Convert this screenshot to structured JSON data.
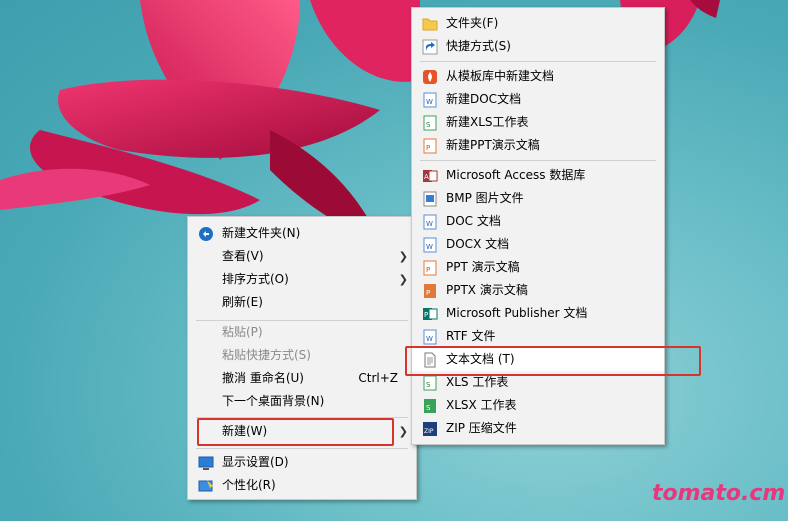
{
  "context_menu": {
    "items": [
      {
        "label": "新建文件夹(N)",
        "icon": "new-folder-icon"
      },
      {
        "label": "查看(V)",
        "submenu": true
      },
      {
        "label": "排序方式(O)",
        "submenu": true
      },
      {
        "label": "刷新(E)"
      },
      {
        "label": "粘贴(P)",
        "disabled": true
      },
      {
        "label": "粘贴快捷方式(S)",
        "disabled": true
      },
      {
        "label": "撤消 重命名(U)",
        "shortcut": "Ctrl+Z"
      },
      {
        "label": "下一个桌面背景(N)"
      },
      {
        "label": "新建(W)",
        "submenu": true,
        "highlighted": true
      },
      {
        "label": "显示设置(D)",
        "icon": "display-settings-icon"
      },
      {
        "label": "个性化(R)",
        "icon": "personalize-icon"
      }
    ]
  },
  "new_submenu": {
    "items": [
      {
        "label": "文件夹(F)",
        "icon": "folder-icon"
      },
      {
        "label": "快捷方式(S)",
        "icon": "shortcut-icon"
      },
      {
        "label": "从模板库中新建文档",
        "icon": "template-icon"
      },
      {
        "label": "新建DOC文档",
        "icon": "doc-icon"
      },
      {
        "label": "新建XLS工作表",
        "icon": "xls-icon"
      },
      {
        "label": "新建PPT演示文稿",
        "icon": "ppt-icon"
      },
      {
        "label": "Microsoft Access 数据库",
        "icon": "access-icon"
      },
      {
        "label": "BMP 图片文件",
        "icon": "bmp-icon"
      },
      {
        "label": "DOC 文档",
        "icon": "doc-icon"
      },
      {
        "label": "DOCX 文档",
        "icon": "docx-icon"
      },
      {
        "label": "PPT 演示文稿",
        "icon": "ppt-icon"
      },
      {
        "label": "PPTX 演示文稿",
        "icon": "pptx-icon"
      },
      {
        "label": "Microsoft Publisher 文档",
        "icon": "publisher-icon"
      },
      {
        "label": "RTF 文件",
        "icon": "rtf-icon"
      },
      {
        "label": "文本文档 (T)",
        "icon": "text-document-icon",
        "highlighted": true
      },
      {
        "label": "XLS 工作表",
        "icon": "xls-icon"
      },
      {
        "label": "XLSX 工作表",
        "icon": "xlsx-icon"
      },
      {
        "label": "ZIP 压缩文件",
        "icon": "zip-icon"
      }
    ]
  },
  "watermark": "tomato.cm",
  "colors": {
    "highlight_box": "#d9342b",
    "watermark": "#e8377a",
    "menu_bg": "#f2f2f2"
  }
}
